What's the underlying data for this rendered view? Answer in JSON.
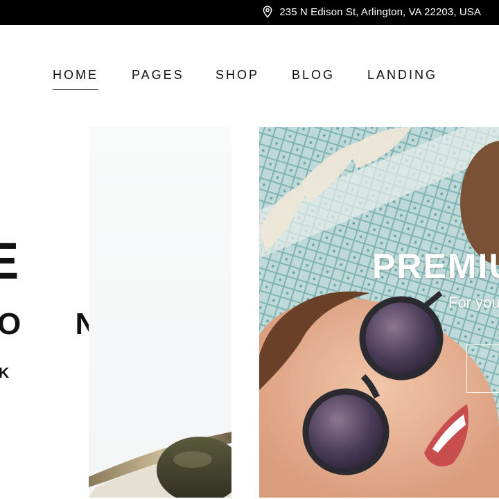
{
  "topbar": {
    "address": "235 N Edison St, Arlington, VA 22203, USA",
    "icon": "map-pin-icon"
  },
  "nav": {
    "items": [
      {
        "label": "HOME",
        "active": true
      },
      {
        "label": "PAGES",
        "active": false
      },
      {
        "label": "SHOP",
        "active": false
      },
      {
        "label": "BLOG",
        "active": false
      },
      {
        "label": "LANDING",
        "active": false
      }
    ]
  },
  "slide_left": {
    "line1": "E",
    "line2": "O N",
    "line3": "K"
  },
  "hero": {
    "title": "PREMIU",
    "subtitle": "For you"
  },
  "colors": {
    "topbar_bg": "#000000",
    "text": "#111111",
    "hero_text": "#ffffff"
  }
}
